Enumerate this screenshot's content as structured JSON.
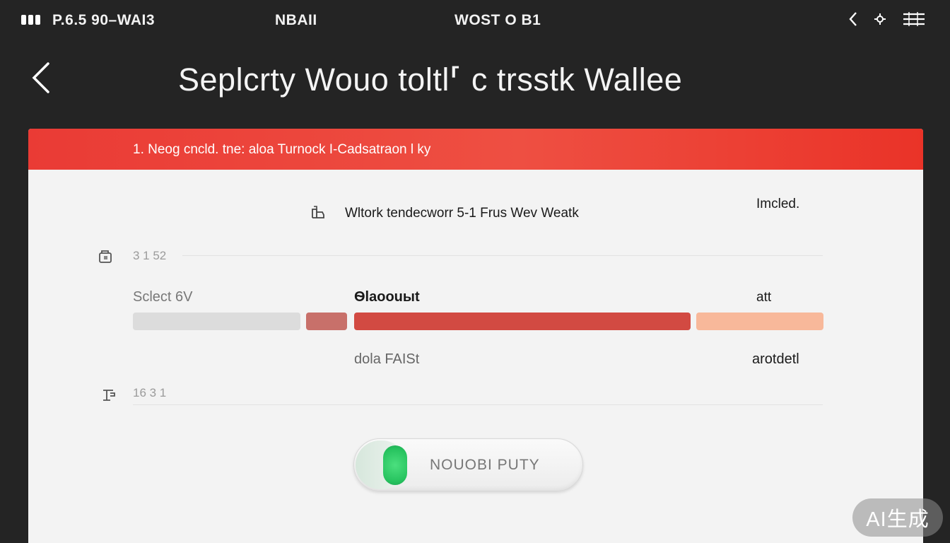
{
  "status_bar": {
    "left_text": "P.6.5 90–WAI3",
    "mid_text_1": "NBAII",
    "mid_text_2": "WOST O B1",
    "icons": [
      "signal-icon",
      "chevron-left-icon",
      "settings-icon",
      "menu-icon"
    ]
  },
  "header": {
    "back_icon": "chevron-left-icon",
    "title": "Seplcrty  Wouo toltl⸢ c trsstk Wallee"
  },
  "banner": {
    "text": "1. Neog cncld. tne: aloa Turnock  I-Cadsatraon l ky",
    "color": "#ea3b35"
  },
  "rows": {
    "network": {
      "label": "Wltork tendecworr 5-1 Frus Wev Weatk",
      "status": "Imcled."
    },
    "item_a": {
      "label": "3 1 52"
    },
    "select": {
      "label": "Sclect 6V",
      "bar_label": "Ѳlaoouыt",
      "right_label": "att",
      "sub_label": "dola FAISt",
      "sub_right": "arotdetl"
    },
    "item_b": {
      "label": "16 3 1"
    }
  },
  "toggle": {
    "label": "NOUOBI PUTY",
    "on": true,
    "accent": "#27c35f"
  },
  "segments_colors": [
    "#dcdcdc",
    "#c8706a",
    "#d24a42",
    "#f8b89a"
  ],
  "watermark": "AI生成"
}
